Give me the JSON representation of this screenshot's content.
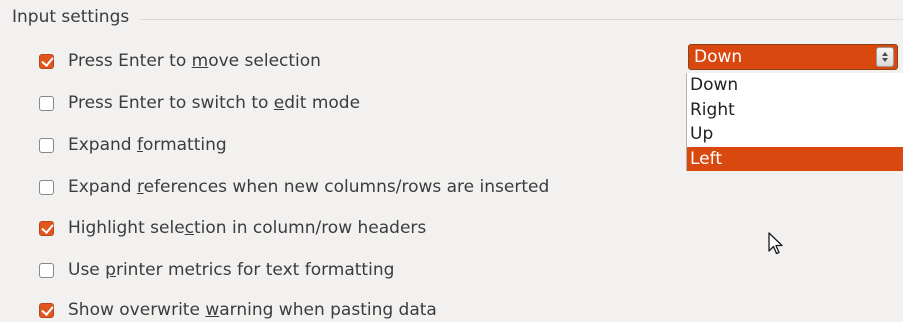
{
  "section": {
    "title": "Input settings"
  },
  "options": [
    {
      "pre": "Press Enter to ",
      "mn": "m",
      "post": "ove selection",
      "checked": true
    },
    {
      "pre": "Press Enter to switch to ",
      "mn": "e",
      "post": "dit mode",
      "checked": false
    },
    {
      "pre": "Expand ",
      "mn": "f",
      "post": "ormatting",
      "checked": false
    },
    {
      "pre": "Expand ",
      "mn": "r",
      "post": "eferences when new columns/rows are inserted",
      "checked": false
    },
    {
      "pre": "Highlight sele",
      "mn": "c",
      "post": "tion in column/row headers",
      "checked": true
    },
    {
      "pre": "Use ",
      "mn": "p",
      "post": "rinter metrics for text formatting",
      "checked": false
    },
    {
      "pre": "Show overwrite ",
      "mn": "w",
      "post": "arning when pasting data",
      "checked": true
    }
  ],
  "direction_dropdown": {
    "value": "Down",
    "options": [
      "Down",
      "Right",
      "Up",
      "Left"
    ],
    "highlighted": "Left"
  },
  "colors": {
    "accent": "#d9490f",
    "background": "#f2f1f0"
  },
  "icons": {
    "checkbox_checked": "check-icon",
    "spin_button": "up-down-arrows-icon",
    "pointer": "mouse-pointer-icon"
  }
}
